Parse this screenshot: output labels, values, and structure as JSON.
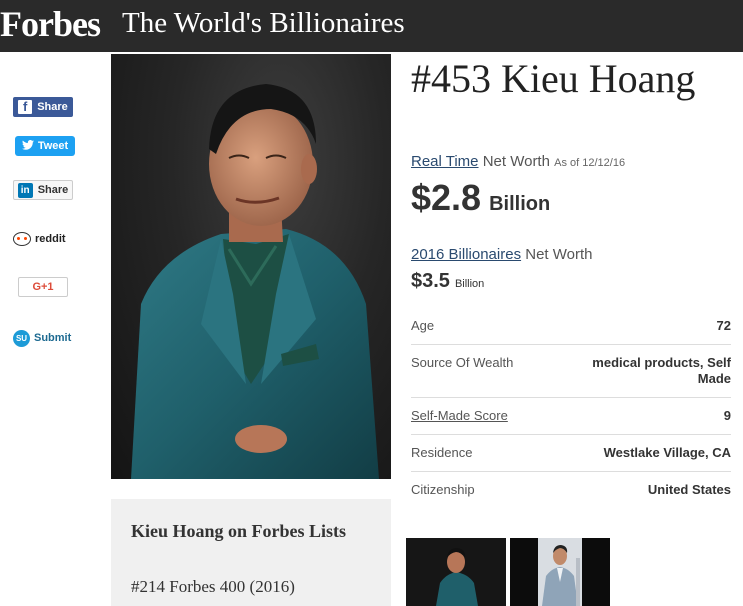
{
  "header": {
    "logo": "Forbes",
    "title": "The World's Billionaires"
  },
  "share": {
    "facebook": "Share",
    "twitter": "Tweet",
    "linkedin": "Share",
    "reddit": "reddit",
    "gplus": "G+1",
    "stumbleupon": "Submit",
    "facebook_icon": "f",
    "linkedin_icon": "in",
    "stumbleupon_icon": "SU"
  },
  "profile": {
    "rank_name": "#453 Kieu Hoang",
    "realtime_link": "Real Time",
    "networth_label": "Net Worth",
    "asof": "As of 12/12/16",
    "networth_value": "$2.8",
    "networth_unit": "Billion",
    "billionaires_link": "2016 Billionaires",
    "networth_label2": "Net Worth",
    "networth2_value": "$3.5",
    "networth2_unit": "Billion"
  },
  "stats": [
    {
      "label": "Age",
      "value": "72"
    },
    {
      "label": "Source Of Wealth",
      "value": "medical products, Self Made"
    },
    {
      "label": "Self-Made Score",
      "value": "9"
    },
    {
      "label": "Residence",
      "value": "Westlake Village, CA"
    },
    {
      "label": "Citizenship",
      "value": "United States"
    }
  ],
  "lists": {
    "title": "Kieu Hoang on Forbes Lists",
    "item": "#214 Forbes 400 (2016)"
  },
  "colors": {
    "topbar": "#2a2a2a",
    "suit": "#1f5f6a",
    "link": "#2a4a6f"
  }
}
